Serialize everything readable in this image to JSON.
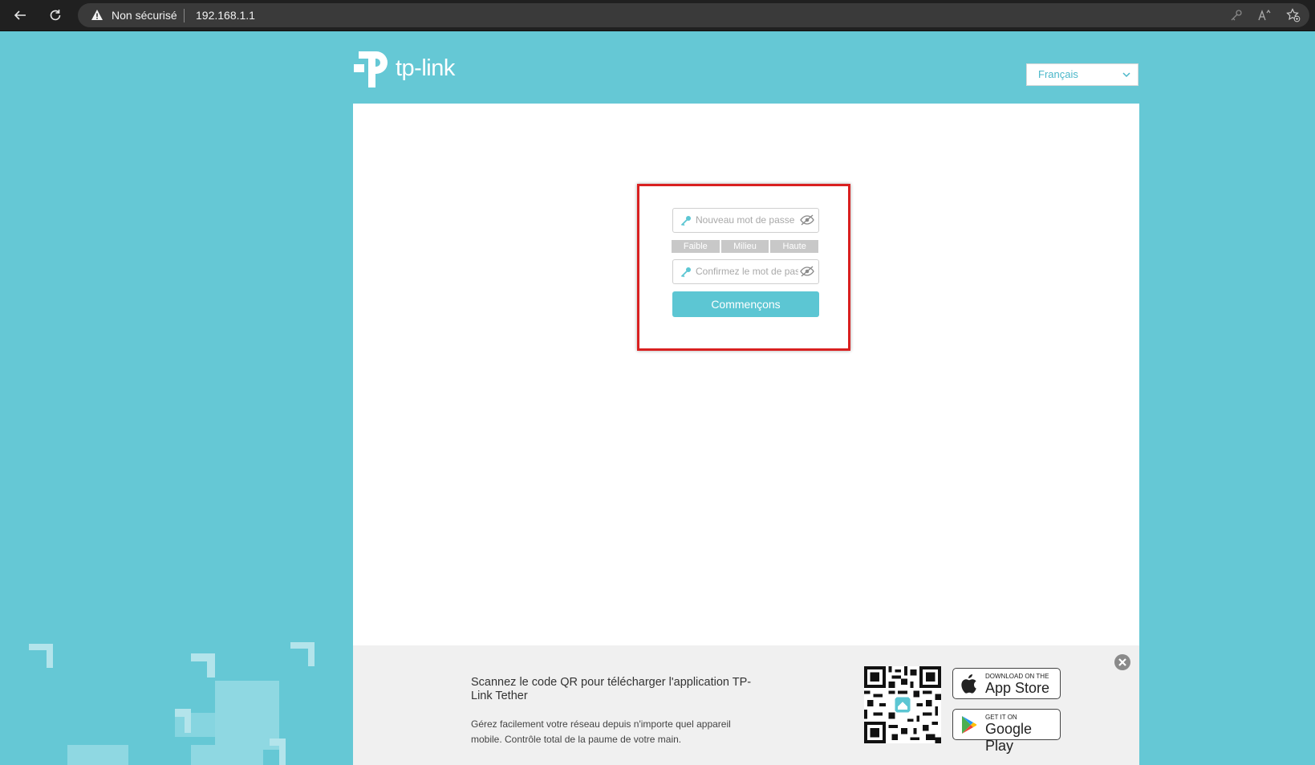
{
  "browser": {
    "security_label": "Non sécurisé",
    "url": "192.168.1.1"
  },
  "header": {
    "logo_text": "tp-link",
    "language": "Français"
  },
  "form": {
    "new_password_placeholder": "Nouveau mot de passe",
    "confirm_password_placeholder": "Confirmez le mot de passe",
    "strength_labels": [
      "Faible",
      "Milieu",
      "Haute"
    ],
    "start_button": "Commençons"
  },
  "footer": {
    "title": "Scannez le code QR pour télécharger l'application TP-Link Tether",
    "description": "Gérez facilement votre réseau depuis n'importe quel appareil mobile. Contrôle total de la paume de votre main.",
    "app_store_small": "DOWNLOAD ON THE",
    "app_store_big": "App Store",
    "google_play_small": "GET IT ON",
    "google_play_big": "Google Play"
  },
  "colors": {
    "brand": "#65c8d5",
    "button": "#5cc6d3",
    "highlight": "#d92020"
  }
}
